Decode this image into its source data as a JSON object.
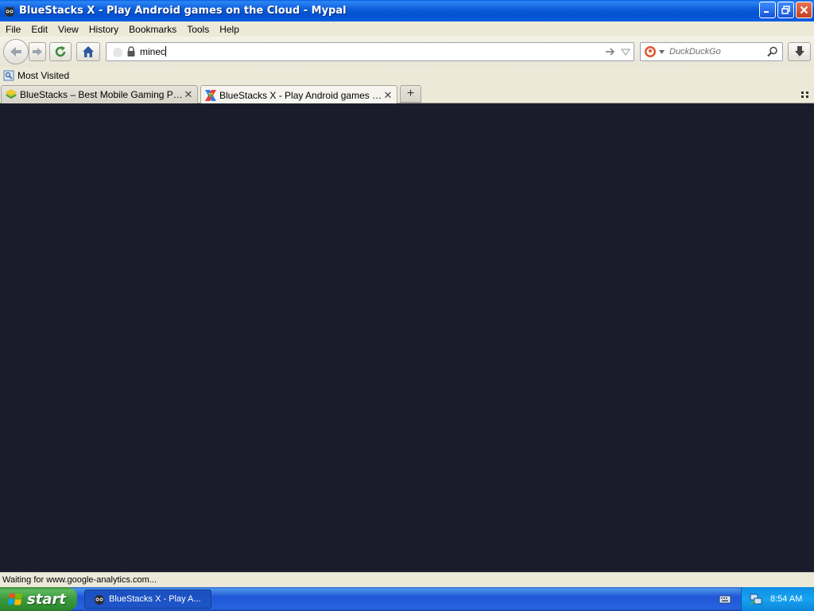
{
  "window": {
    "title": "BlueStacks X - Play Android games on the Cloud - Mypal",
    "app_icon": "mypal-raccoon-icon"
  },
  "menu": {
    "items": [
      {
        "label": "File"
      },
      {
        "label": "Edit"
      },
      {
        "label": "View"
      },
      {
        "label": "History"
      },
      {
        "label": "Bookmarks"
      },
      {
        "label": "Tools"
      },
      {
        "label": "Help"
      }
    ]
  },
  "navbar": {
    "url_value": "minec",
    "search_placeholder": "DuckDuckGo",
    "search_engine_icon": "duckduckgo-icon"
  },
  "bookmarks": {
    "items": [
      {
        "label": "Most Visited",
        "icon": "most-visited-icon"
      }
    ]
  },
  "tabs": [
    {
      "label": "BlueStacks – Best Mobile Gaming Platform...",
      "active": false,
      "icon": "bluestacks-icon"
    },
    {
      "label": "BlueStacks X - Play Android games on the...",
      "active": true,
      "icon": "bluestacks-x-icon"
    }
  ],
  "status": {
    "text": "Waiting for www.google-analytics.com..."
  },
  "taskbar": {
    "start_label": "start",
    "task_label": "BlueStacks X - Play A...",
    "clock": "8:54 AM"
  },
  "colors": {
    "content_bg": "#1b1c2b",
    "titlebar": "#0b5ad8",
    "taskbar": "#2157d7",
    "start_green": "#3a9a3a"
  }
}
